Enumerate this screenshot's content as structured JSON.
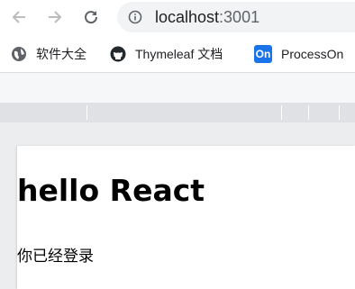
{
  "browser": {
    "address": {
      "host": "localhost",
      "port": ":3001"
    },
    "buttons": {
      "back_icon": "arrow-left",
      "forward_icon": "arrow-right",
      "reload_icon": "reload"
    }
  },
  "bookmarks": [
    {
      "label": "软件大全",
      "icon": "globe-icon"
    },
    {
      "label": "Thymeleaf 文档",
      "icon": "github-icon"
    },
    {
      "label": "ProcessOn",
      "icon": "processon-icon",
      "icon_text": "On"
    }
  ],
  "page": {
    "heading": "hello React",
    "message": "你已经登录"
  },
  "colors": {
    "icon": "#5f6368",
    "address_bar_bg": "#f1f3f4",
    "processon_blue": "#1a73e8",
    "ruler_bg": "#dfe1e5",
    "viewport_bg": "#ecedef"
  }
}
